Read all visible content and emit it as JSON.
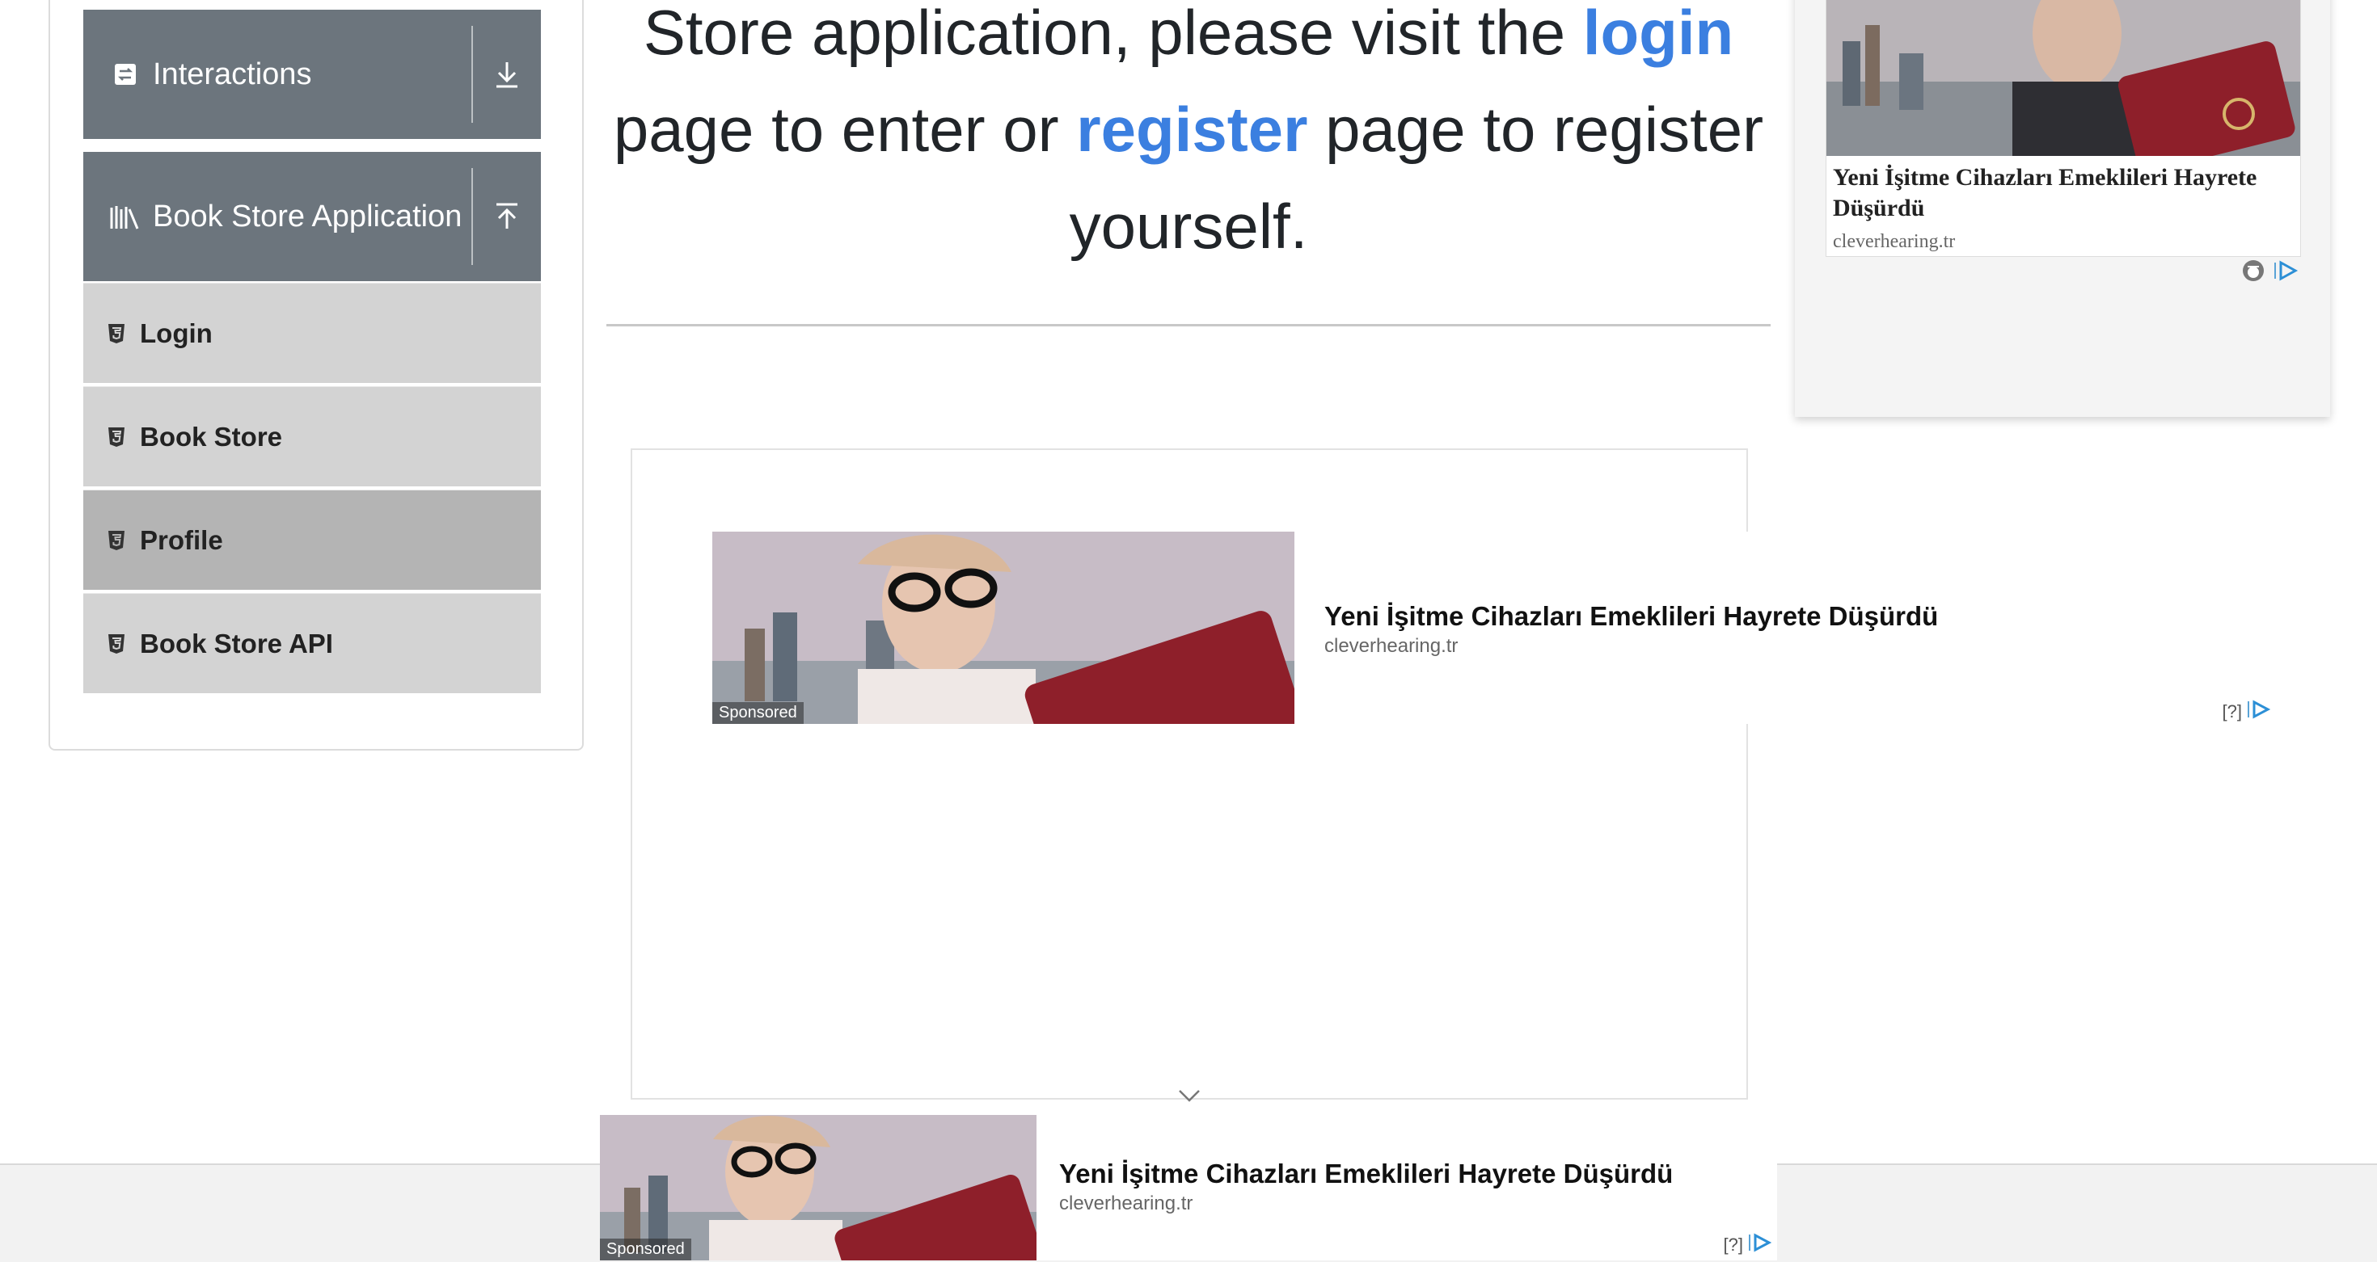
{
  "sidebar": {
    "groups": [
      {
        "label": "Interactions",
        "icon": "interactions-icon",
        "toggle_icon": "download-arrow-icon"
      },
      {
        "label": "Book Store Application",
        "icon": "books-icon",
        "toggle_icon": "upload-arrow-icon"
      }
    ],
    "items": [
      {
        "label": "Login",
        "active": false
      },
      {
        "label": "Book Store",
        "active": false
      },
      {
        "label": "Profile",
        "active": true
      },
      {
        "label": "Book Store API",
        "active": false
      }
    ]
  },
  "main": {
    "line1_prefix": "Store application, please visit the",
    "login_link": "login",
    "line2_prefix": "page to enter or",
    "register_link": "register",
    "line2_suffix": "page to register",
    "line3": "yourself."
  },
  "ads": {
    "title": "Yeni İşitme Cihazları Emeklileri Hayrete Düşürdü",
    "domain": "cleverhearing.tr",
    "sponsored": "Sponsored",
    "help": "[?]"
  },
  "colors": {
    "accent_link": "#3b7fe0",
    "group_header": "#6c757d",
    "menu_item": "#d3d3d3",
    "menu_item_active": "#b4b4b4"
  }
}
